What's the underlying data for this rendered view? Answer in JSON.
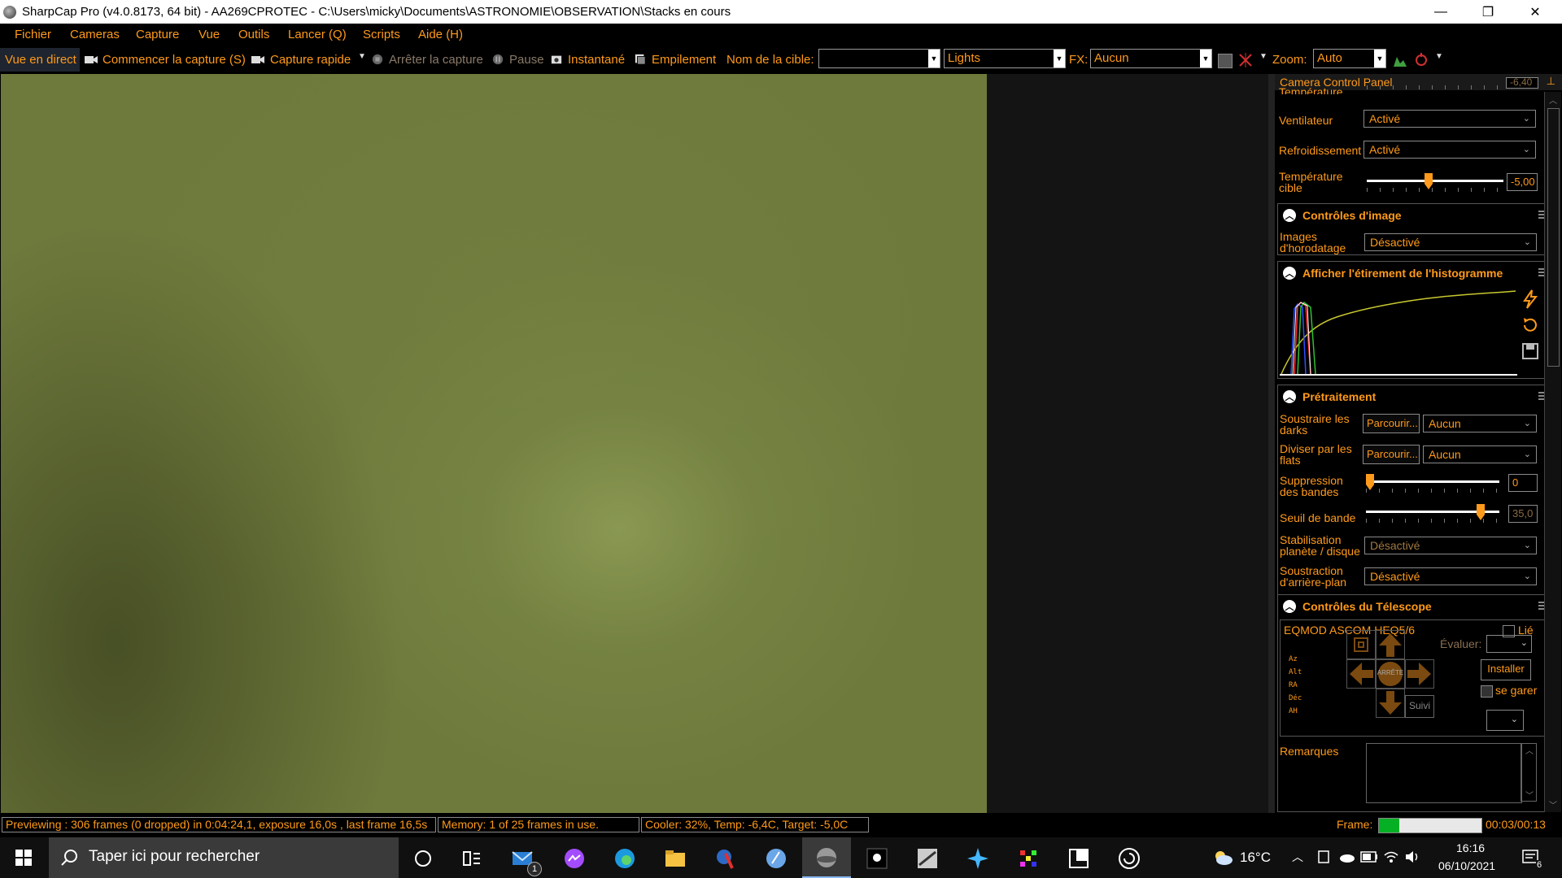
{
  "window": {
    "title": "SharpCap Pro (v4.0.8173, 64 bit) - AA269CPROTEC - C:\\Users\\micky\\Documents\\ASTRONOMIE\\OBSERVATION\\Stacks en cours",
    "minimize_glyph": "—",
    "restore_glyph": "❐",
    "close_glyph": "✕"
  },
  "menu": [
    "Fichier",
    "Cameras",
    "Capture",
    "Vue",
    "Outils",
    "Lancer (Q)",
    "Scripts",
    "Aide (H)"
  ],
  "toolbar": {
    "live": "Vue en direct",
    "start_capture": "Commencer la capture (S)",
    "quick_capture": "Capture rapide",
    "stop_capture": "Arrêter la capture",
    "pause": "Pause",
    "snapshot": "Instantané",
    "stacking": "Empilement",
    "target_label": "Nom de la cible:",
    "target_value": "",
    "frame_type": "Lights",
    "fx_label": "FX:",
    "fx_value": "Aucun",
    "zoom_label": "Zoom:",
    "zoom_value": "Auto"
  },
  "panel": {
    "title": "Camera Control Panel",
    "temperature_partial": "Température",
    "temperature_value": "-6,40",
    "fan_label": "Ventilateur",
    "fan_value": "Activé",
    "cooling_label": "Refroidissement",
    "cooling_value": "Activé",
    "target_temp_label_1": "Température",
    "target_temp_label_2": "cible",
    "target_temp_value": "-5,00",
    "target_temp_level": 0.45,
    "image_controls": {
      "title": "Contrôles d'image",
      "timestamp_label_1": "Images",
      "timestamp_label_2": "d'horodatage",
      "timestamp_value": "Désactivé"
    },
    "histogram": {
      "title": "Afficher l'étirement de l'histogramme"
    },
    "preprocessing": {
      "title": "Prétraitement",
      "darks_label_1": "Soustraire les",
      "darks_label_2": "darks",
      "darks_browse": "Parcourir...",
      "darks_value": "Aucun",
      "flats_label_1": "Diviser par les",
      "flats_label_2": "flats",
      "flats_browse": "Parcourir...",
      "flats_value": "Aucun",
      "banding_label_1": "Suppression",
      "banding_label_2": "des bandes",
      "banding_value": "0",
      "banding_level": 0.0,
      "threshold_label": "Seuil de bande",
      "threshold_value": "35,0",
      "threshold_level": 0.88,
      "stabilization_label_1": "Stabilisation",
      "stabilization_label_2": "planète / disque",
      "stabilization_value": "Désactivé",
      "background_label_1": "Soustraction",
      "background_label_2": "d'arrière-plan",
      "background_value": "Désactivé"
    },
    "telescope": {
      "title": "Contrôles du Télescope",
      "mount": "EQMOD ASCOM HEQ5/6",
      "linked_label": "Lié",
      "rate_label": "Évaluer:",
      "coords": [
        "Az",
        "Alt",
        "RA",
        "Déc",
        "AH"
      ],
      "stop_label": "ARRÊTE",
      "install_label": "Installer",
      "park_label": "se garer",
      "tracking_label": "Suivi",
      "notes_label": "Remarques"
    }
  },
  "status": {
    "preview": "Previewing : 306 frames (0 dropped) in 0:04:24,1, exposure 16,0s , last frame 16,5s",
    "memory": "Memory: 1 of 25 frames in use.",
    "cooler": "Cooler: 32%, Temp: -6,4C, Target: -5,0C",
    "frame_label": "Frame:",
    "frame_progress": 0.2,
    "frame_time": "00:03/00:13"
  },
  "taskbar": {
    "search_placeholder": "Taper ici pour rechercher",
    "mail_badge": "1",
    "temperature": "16°C",
    "time": "16:16",
    "date": "06/10/2021",
    "notif_count": "6"
  },
  "colors": {
    "accent": "#ff9a1a",
    "preview_green": "#6e7a3c",
    "panel_bg": "#000000"
  }
}
